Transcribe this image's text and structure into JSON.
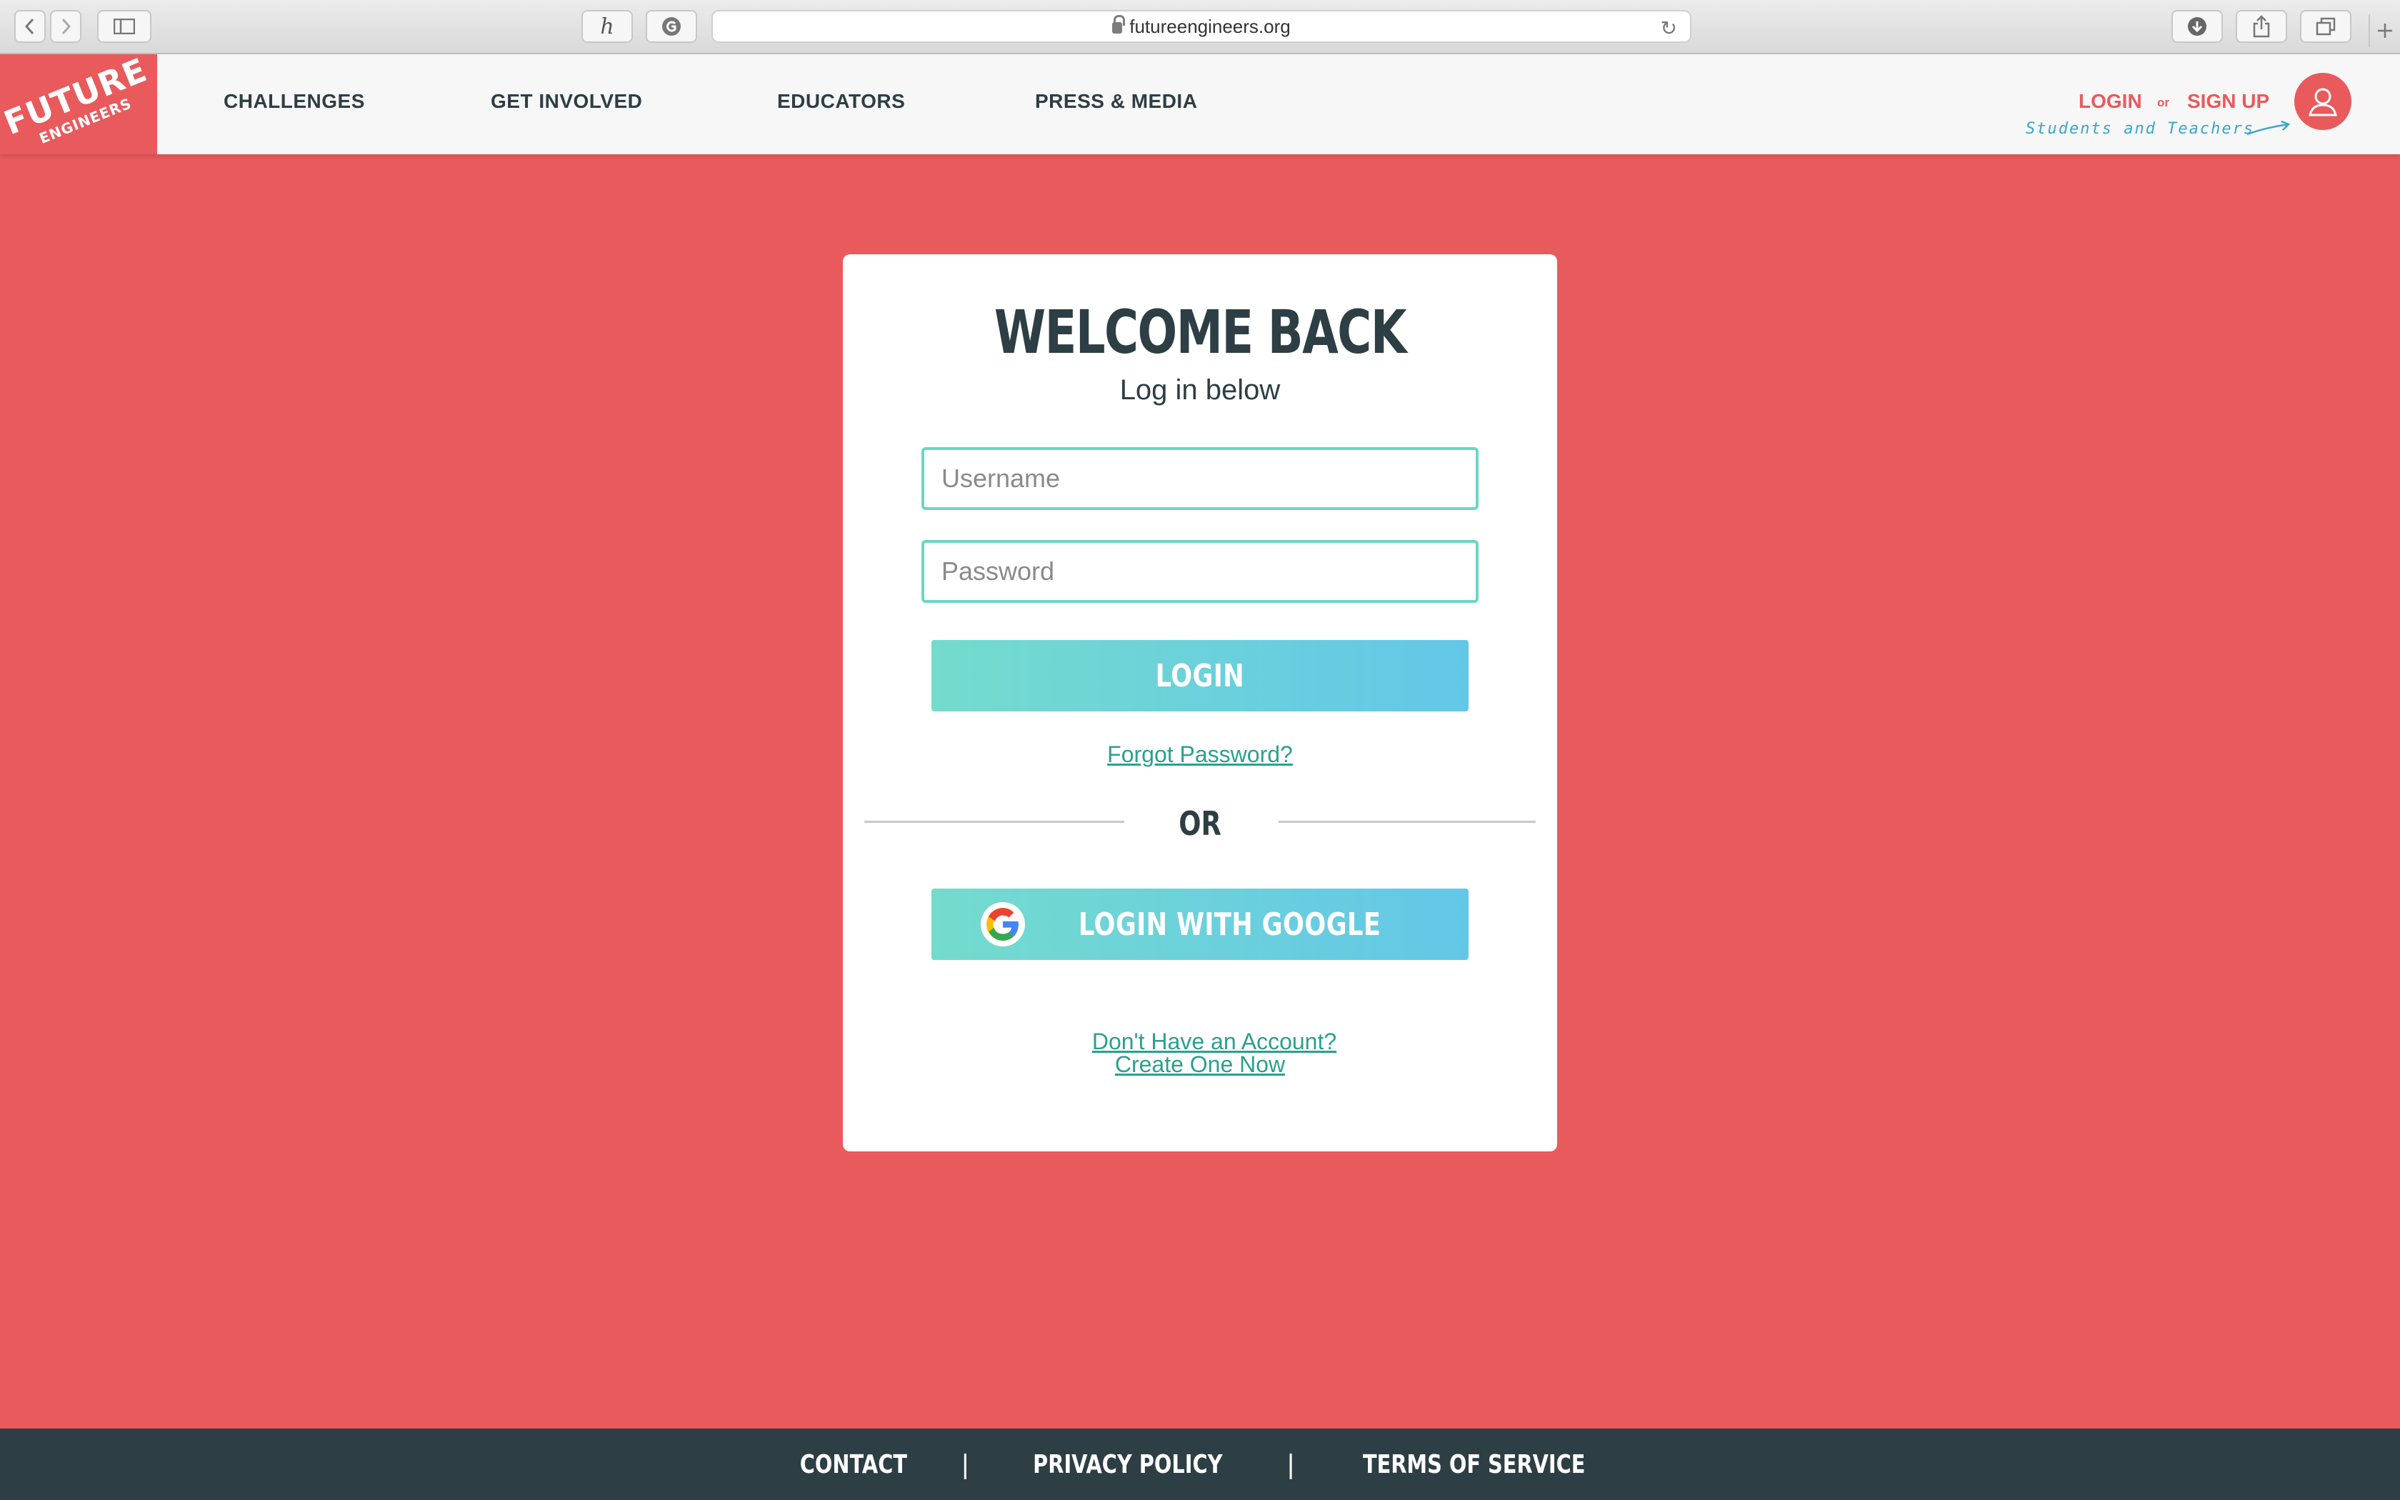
{
  "browser": {
    "url": "futureengineers.org",
    "extension_h": "h"
  },
  "header": {
    "logo_line1": "FUTURE",
    "logo_line2": "ENGINEERS",
    "nav": [
      {
        "label": "CHALLENGES"
      },
      {
        "label": "GET INVOLVED"
      },
      {
        "label": "EDUCATORS"
      },
      {
        "label": "PRESS & MEDIA"
      }
    ],
    "login": "LOGIN",
    "or": "or",
    "signup": "SIGN UP",
    "note": "Students and Teachers"
  },
  "form": {
    "title": "WELCOME BACK",
    "subtitle": "Log in below",
    "username_placeholder": "Username",
    "password_placeholder": "Password",
    "login_button": "LOGIN",
    "forgot_link": "Forgot Password?",
    "or_text": "OR",
    "google_button": "LOGIN WITH GOOGLE",
    "no_account": "Don't Have an Account?",
    "create_one": "Create One Now"
  },
  "footer": {
    "contact": "CONTACT",
    "privacy": "PRIVACY POLICY",
    "terms": "TERMS OF SERVICE",
    "separator": "|"
  },
  "colors": {
    "brand": "#e95a5c",
    "dark": "#2d3e44",
    "teal": "#6cd6c4",
    "link": "#2ba08e"
  }
}
